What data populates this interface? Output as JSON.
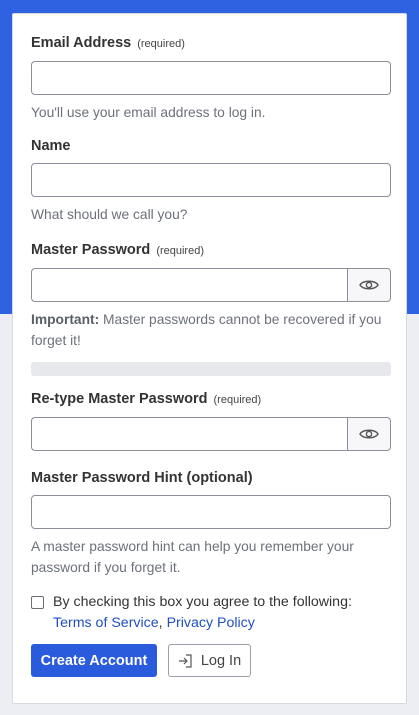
{
  "form": {
    "email": {
      "label": "Email Address",
      "required": "(required)",
      "value": "",
      "help": "You'll use your email address to log in."
    },
    "name": {
      "label": "Name",
      "value": "",
      "help": "What should we call you?"
    },
    "master_password": {
      "label": "Master Password",
      "required": "(required)",
      "value": "",
      "help_strong": "Important:",
      "help": " Master passwords cannot be recovered if you forget it!",
      "toggle_icon": "eye-icon"
    },
    "strength_meter": {
      "level": 0
    },
    "retype_password": {
      "label": "Re-type Master Password",
      "required": "(required)",
      "value": "",
      "toggle_icon": "eye-icon"
    },
    "hint": {
      "label": "Master Password Hint (optional)",
      "value": "",
      "help": "A master password hint can help you remember your password if you forget it."
    },
    "agreement": {
      "checked": false,
      "text": "By checking this box you agree to the following:",
      "terms_link": "Terms of Service",
      "separator": ",",
      "privacy_link": "Privacy Policy"
    },
    "buttons": {
      "create": "Create Account",
      "login": "Log In",
      "login_icon": "sign-in-icon"
    }
  },
  "colors": {
    "brand": "#2f62e0",
    "primary_button": "#2a5bdc",
    "link": "#1f4fc2",
    "page_background": "#eceef3"
  }
}
